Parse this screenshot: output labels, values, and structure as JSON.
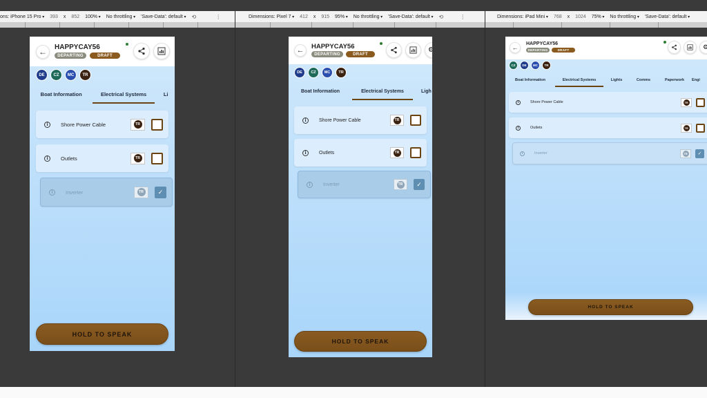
{
  "toolbars": [
    {
      "device": "ons: iPhone 15 Pro",
      "width": "393",
      "x": "x",
      "height": "852",
      "zoom": "100%",
      "throttle": "No throttling",
      "save": "'Save-Data': default"
    },
    {
      "device": "Dimensions: Pixel 7",
      "width": "412",
      "x": "x",
      "height": "915",
      "zoom": "95%",
      "throttle": "No throttling",
      "save": "'Save-Data': default"
    },
    {
      "device": "Dimensions: iPad Mini",
      "width": "768",
      "x": "x",
      "height": "1024",
      "zoom": "75%",
      "throttle": "No throttling",
      "save": "'Save-Data': default"
    }
  ],
  "app": {
    "title": "HAPPYCAY56",
    "badge_departing": "DEPARTING",
    "badge_draft": "DRAFT",
    "status_color": "#2e7d32",
    "accent": "#8a5a1e"
  },
  "phones": [
    {
      "avatars": [
        {
          "initials": "DE",
          "color": "#1f3d8c"
        },
        {
          "initials": "CZ",
          "color": "#1d6a5a"
        },
        {
          "initials": "MC",
          "color": "#2a4fae"
        },
        {
          "initials": "TR",
          "color": "#3b2210"
        }
      ],
      "tabs": [
        "Boat Information",
        "Electrical Systems",
        "Li"
      ]
    },
    {
      "avatars": [
        {
          "initials": "DE",
          "color": "#1f3d8c"
        },
        {
          "initials": "CZ",
          "color": "#1d6a5a"
        },
        {
          "initials": "MC",
          "color": "#2a4fae"
        },
        {
          "initials": "TR",
          "color": "#3b2210"
        }
      ],
      "tabs": [
        "Boat Information",
        "Electrical Systems",
        "Ligh"
      ]
    },
    {
      "avatars": [
        {
          "initials": "CZ",
          "color": "#1d6a5a"
        },
        {
          "initials": "DE",
          "color": "#1f3d8c"
        },
        {
          "initials": "MC",
          "color": "#2a4fae"
        },
        {
          "initials": "TR",
          "color": "#3b2210"
        }
      ],
      "tabs": [
        "Boat Information",
        "Electrical Systems",
        "Lights",
        "Comms",
        "Paperwork",
        "Engi"
      ]
    }
  ],
  "checklist": [
    {
      "label": "Shore Power Cable",
      "owner": "TR",
      "checked": false
    },
    {
      "label": "Outlets",
      "owner": "TR",
      "checked": false
    },
    {
      "label": "Inverter",
      "owner": "TR",
      "checked": true
    }
  ],
  "info_glyph": "i",
  "check_glyph": "✓",
  "speak_label": "HOLD TO SPEAK"
}
